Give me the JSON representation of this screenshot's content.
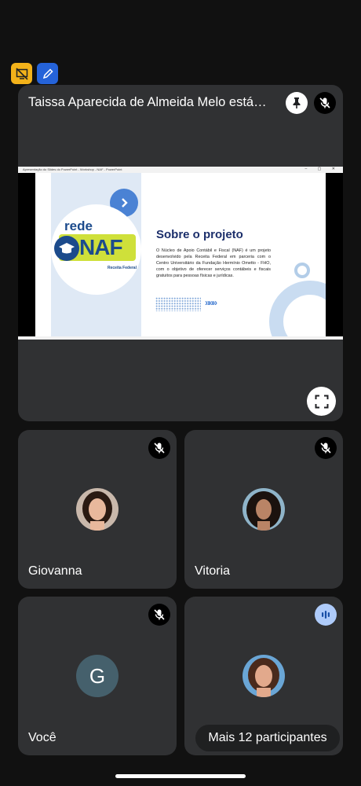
{
  "top_icons": [
    {
      "icon": "screen-share-off-icon",
      "color": "#f3b21a"
    },
    {
      "icon": "pen-annotate-icon",
      "color": "#2563d9"
    }
  ],
  "presentation": {
    "presenter_label": "Taissa Aparecida de Almeida Melo está apresentando",
    "pin_icon": "pin-icon",
    "mic_icon": "mic-off-icon",
    "expand_icon": "fullscreen-icon",
    "slide": {
      "window_title": "Apresentação do Slides do PowerPoint  -  Workshop - NAF - PowerPoint",
      "logo_rede": "rede",
      "logo_naf": "NAF",
      "logo_receita": "Receita Federal",
      "title": "Sobre o projeto",
      "body": "O Núcleo de Apoio Contábil e Fiscal (NAF) é um projeto desenvolvido pela Receita Federal em parceria com o Centro Universitário da Fundação Hermínio Ometto - FHO, com o objetivo de oferecer serviços contábeis e fiscais gratuitos para pessoas físicas e jurídicas.",
      "chevrons": "»»»",
      "accent_color": "#1c4b8c"
    }
  },
  "participants": [
    {
      "name": "Giovanna",
      "mic": "mic-off-icon"
    },
    {
      "name": "Vitoria",
      "mic": "mic-off-icon"
    },
    {
      "name": "Você",
      "initial": "G",
      "mic": "mic-off-icon"
    },
    {
      "name": "",
      "mic": "speaking-icon"
    }
  ],
  "more_participants": "Mais 12 participantes"
}
